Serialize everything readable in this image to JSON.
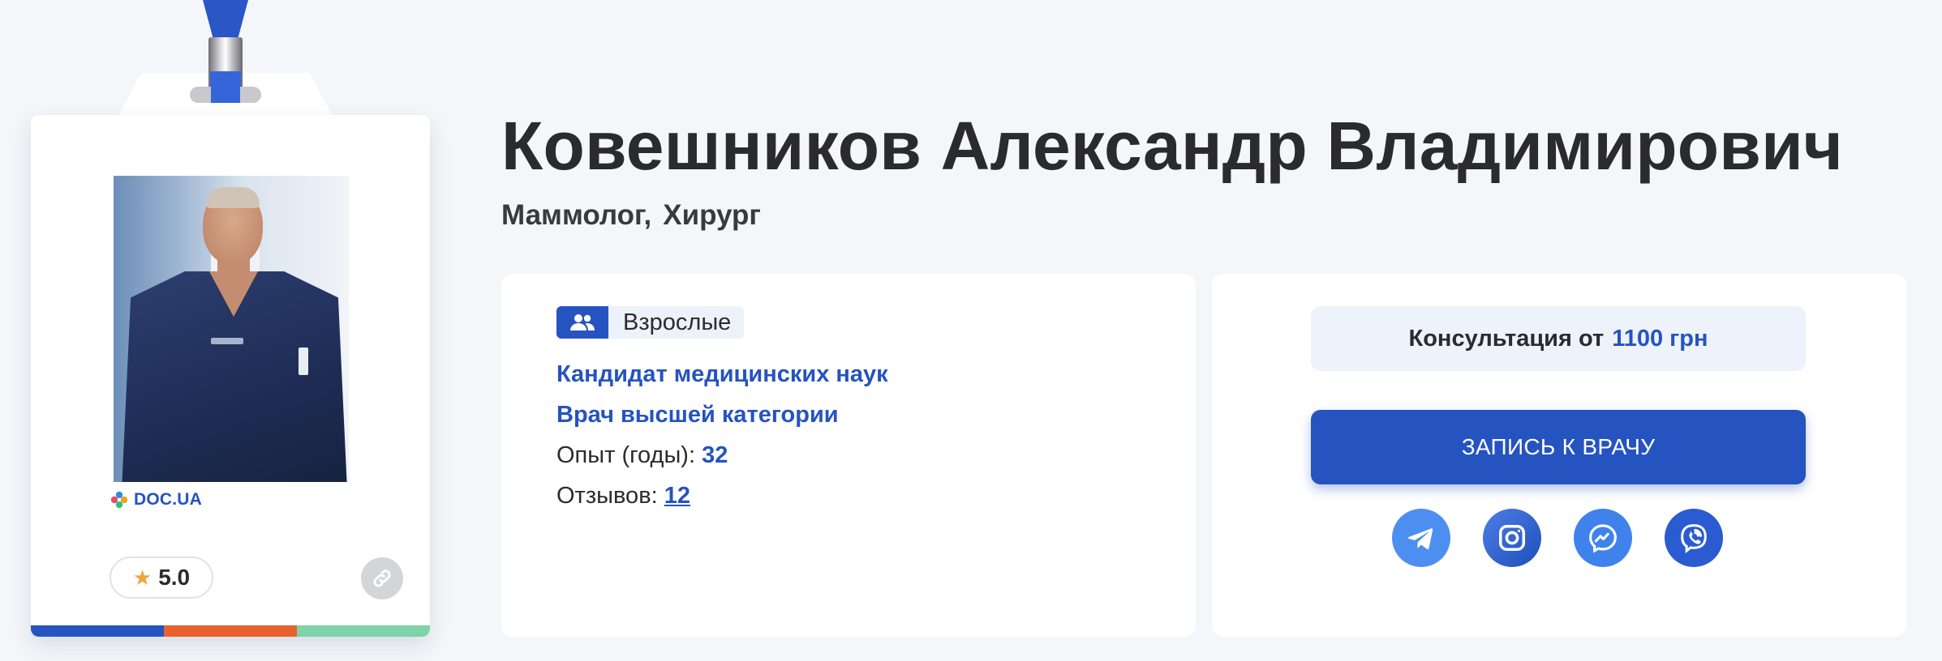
{
  "doctor": {
    "name": "Ковешников Александр Владимирович",
    "specialties": [
      "Маммолог,",
      "Хирург"
    ]
  },
  "badge": {
    "source_label": "DOC.UA",
    "rating": "5.0",
    "stripe_colors": [
      "#2553c0",
      "#e8612e",
      "#7fd3a8"
    ]
  },
  "info": {
    "age_group": "Взрослые",
    "degree": "Кандидат медицинских наук",
    "category": "Врач высшей категории",
    "experience_label": "Опыт (годы):",
    "experience_value": "32",
    "reviews_label": "Отзывов:",
    "reviews_value": "12"
  },
  "booking": {
    "price_label": "Консультация от",
    "price_value": "1100 грн",
    "button_label": "ЗАПИСЬ К ВРАЧУ",
    "socials": [
      "telegram-icon",
      "instagram-icon",
      "messenger-icon",
      "viber-icon"
    ]
  },
  "colors": {
    "accent": "#2553c0",
    "background": "#f4f6fa",
    "text": "#2b2b2f"
  }
}
